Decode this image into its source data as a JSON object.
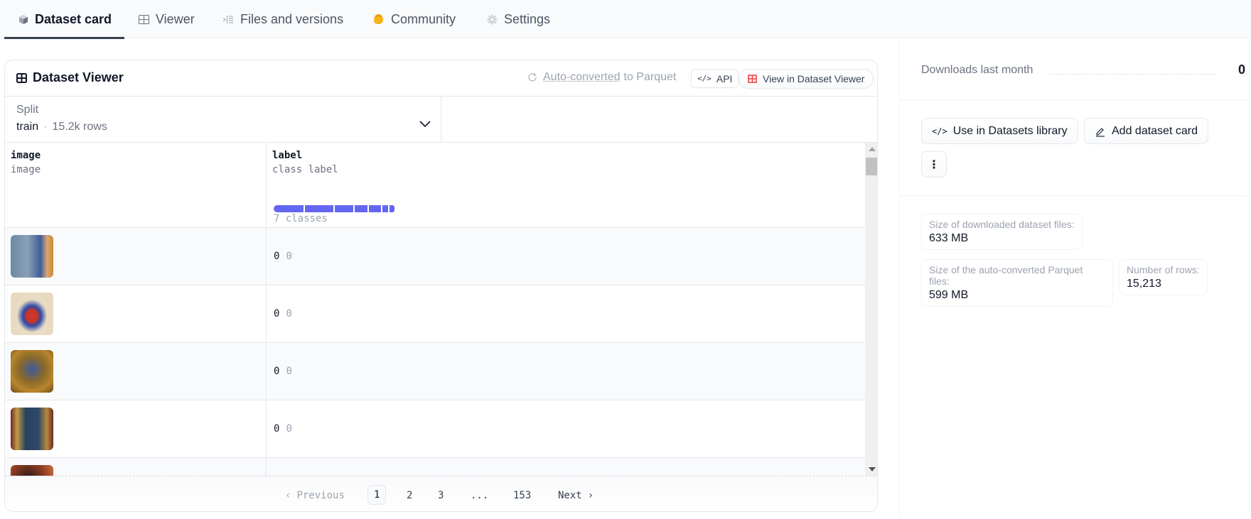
{
  "tabs": [
    {
      "label": "Dataset card",
      "icon": "cube-icon",
      "active": true
    },
    {
      "label": "Viewer",
      "icon": "table-icon",
      "active": false
    },
    {
      "label": "Files and versions",
      "icon": "files-icon",
      "active": false
    },
    {
      "label": "Community",
      "icon": "hand-wave-icon",
      "active": false
    },
    {
      "label": "Settings",
      "icon": "gear-icon",
      "active": false
    }
  ],
  "viewer": {
    "title": "Dataset Viewer",
    "autoconverted_link": "Auto-converted",
    "autoconverted_suffix": "to Parquet",
    "api_label": "API",
    "view_label": "View in Dataset Viewer",
    "split": {
      "label": "Split",
      "value": "train",
      "rows": "15.2k rows"
    },
    "columns": [
      {
        "name": "image",
        "type": "image"
      },
      {
        "name": "label",
        "type": "class label",
        "classes_text": "7 classes"
      }
    ],
    "class_distribution": [
      0.2,
      0.19,
      0.125,
      0.085,
      0.08,
      0.04,
      0.035
    ],
    "rows": [
      {
        "thumb": "illuminated-manuscript-1",
        "label": "0",
        "label_name": "0"
      },
      {
        "thumb": "illuminated-manuscript-2",
        "label": "0",
        "label_name": "0"
      },
      {
        "thumb": "illuminated-manuscript-3",
        "label": "0",
        "label_name": "0"
      },
      {
        "thumb": "illuminated-manuscript-4",
        "label": "0",
        "label_name": "0"
      },
      {
        "thumb": "illuminated-manuscript-5",
        "label": "",
        "label_name": ""
      }
    ],
    "pagination": {
      "previous": "Previous",
      "pages": [
        "1",
        "2",
        "3",
        "...",
        "153"
      ],
      "current": "1",
      "next": "Next"
    }
  },
  "sidebar": {
    "downloads_label": "Downloads last month",
    "downloads_value": "0",
    "use_library_label": "Use in Datasets library",
    "add_card_label": "Add dataset card",
    "more_label": "⋮",
    "stats": [
      {
        "key": "Size of downloaded dataset files:",
        "value": "633 MB"
      },
      {
        "key": "Size of the auto-converted Parquet files:",
        "value": "599 MB"
      },
      {
        "key": "Number of rows:",
        "value": "15,213"
      }
    ]
  },
  "colors": {
    "accent": "#6366f1",
    "active_tab": "#374151",
    "view_icon": "#ef4444"
  }
}
